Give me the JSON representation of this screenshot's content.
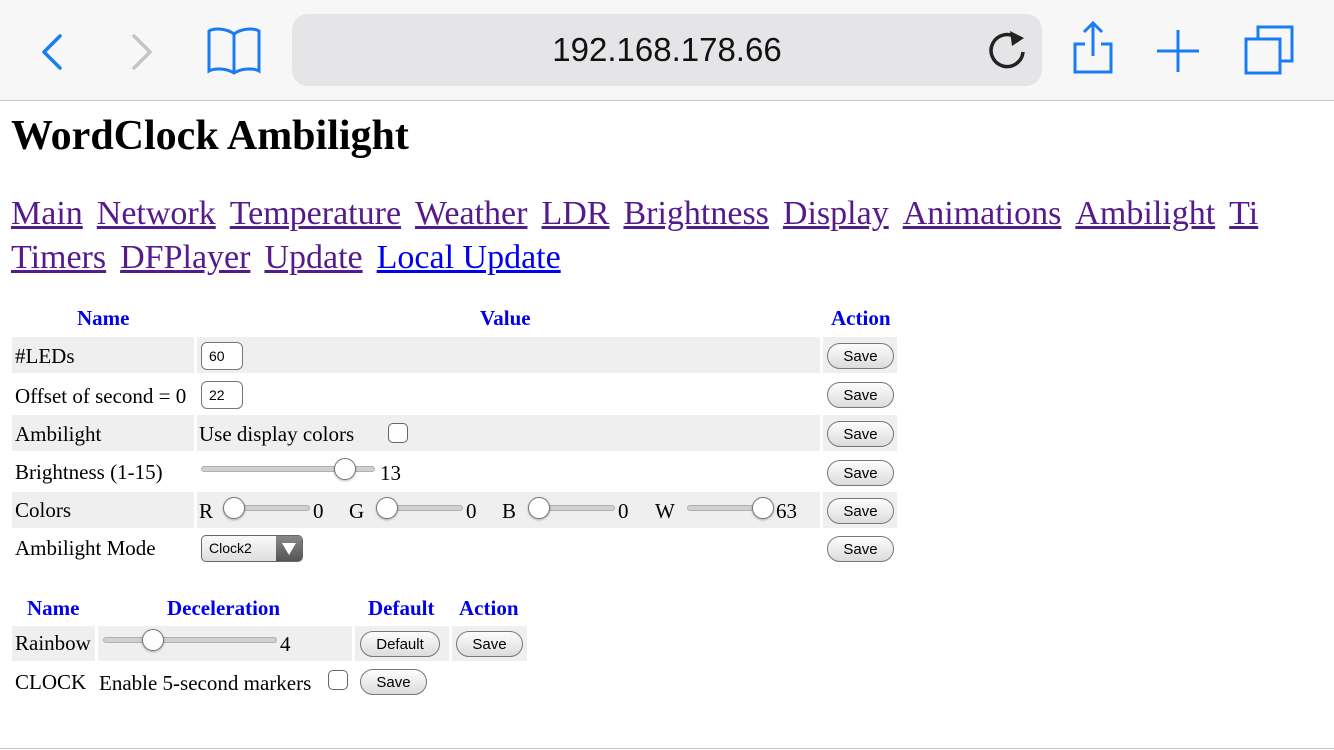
{
  "browser": {
    "url": "192.168.178.66",
    "icons": [
      "back-icon",
      "forward-icon",
      "bookmarks-icon",
      "reload-icon",
      "share-icon",
      "new-tab-icon",
      "tabs-icon"
    ]
  },
  "page": {
    "title": "WordClock Ambilight",
    "nav": [
      "Main",
      "Network",
      "Temperature",
      "Weather",
      "LDR",
      "Brightness",
      "Display",
      "Animations",
      "Ambilight",
      "Ti"
    ],
    "nav2": [
      "Timers",
      "DFPlayer",
      "Update",
      "Local Update"
    ]
  },
  "table1": {
    "headers": {
      "name": "Name",
      "value": "Value",
      "action": "Action"
    },
    "rows": {
      "leds": {
        "name": "#LEDs",
        "value": "60",
        "action": "Save"
      },
      "offset": {
        "name": "Offset of second = 0",
        "value": "22",
        "action": "Save"
      },
      "ambilight": {
        "name": "Ambilight",
        "value": "Use display colors",
        "action": "Save"
      },
      "brightness": {
        "name": "Brightness (1-15)",
        "value": "13",
        "action": "Save",
        "slider_value": 13,
        "min": 1,
        "max": 15
      },
      "colors": {
        "name": "Colors",
        "action": "Save",
        "r_label": "R",
        "r": "0",
        "g_label": "G",
        "g": "0",
        "b_label": "B",
        "b": "0",
        "w_label": "W",
        "w": "63"
      },
      "mode": {
        "name": "Ambilight Mode",
        "value": "Clock2",
        "action": "Save"
      }
    }
  },
  "table2": {
    "headers": {
      "name": "Name",
      "deceleration": "Deceleration",
      "default": "Default",
      "action": "Action"
    },
    "rainbow": {
      "name": "Rainbow",
      "value": "4",
      "default": "Default",
      "action": "Save"
    },
    "clock": {
      "name": "CLOCK",
      "label": "Enable 5-second markers",
      "action": "Save"
    }
  }
}
